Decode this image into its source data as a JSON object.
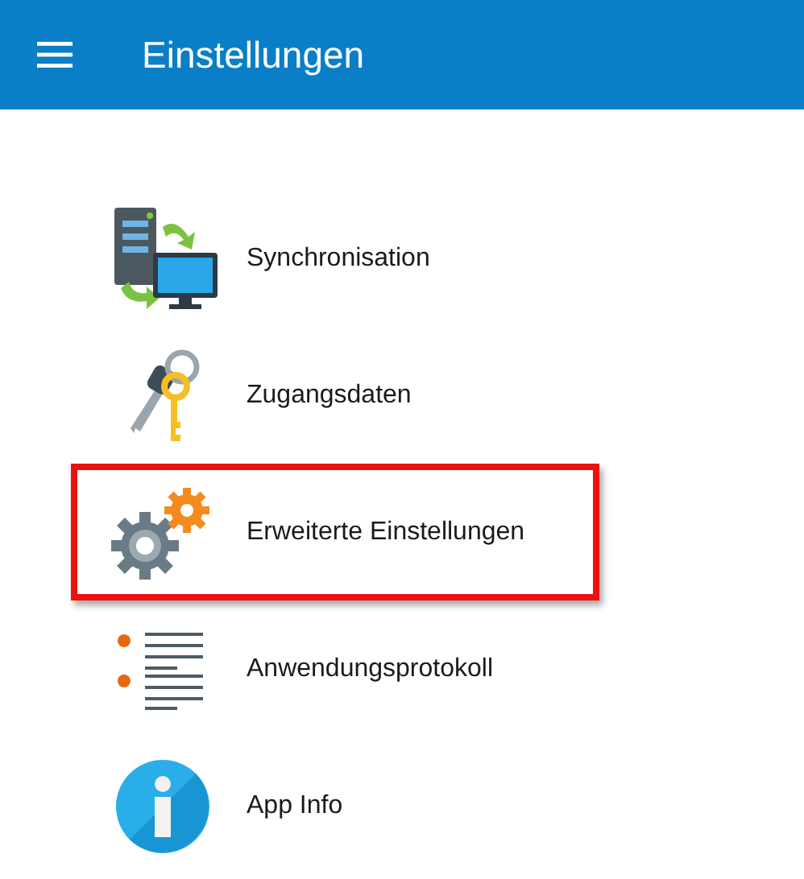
{
  "app_bar": {
    "title": "Einstellungen"
  },
  "items": [
    {
      "kind": "sync",
      "label": "Synchronisation",
      "highlighted": false
    },
    {
      "kind": "keys",
      "label": "Zugangsdaten",
      "highlighted": false
    },
    {
      "kind": "gears",
      "label": "Erweiterte Einstellungen",
      "highlighted": true
    },
    {
      "kind": "log",
      "label": "Anwendungsprotokoll",
      "highlighted": false
    },
    {
      "kind": "info",
      "label": "App Info",
      "highlighted": false
    }
  ]
}
